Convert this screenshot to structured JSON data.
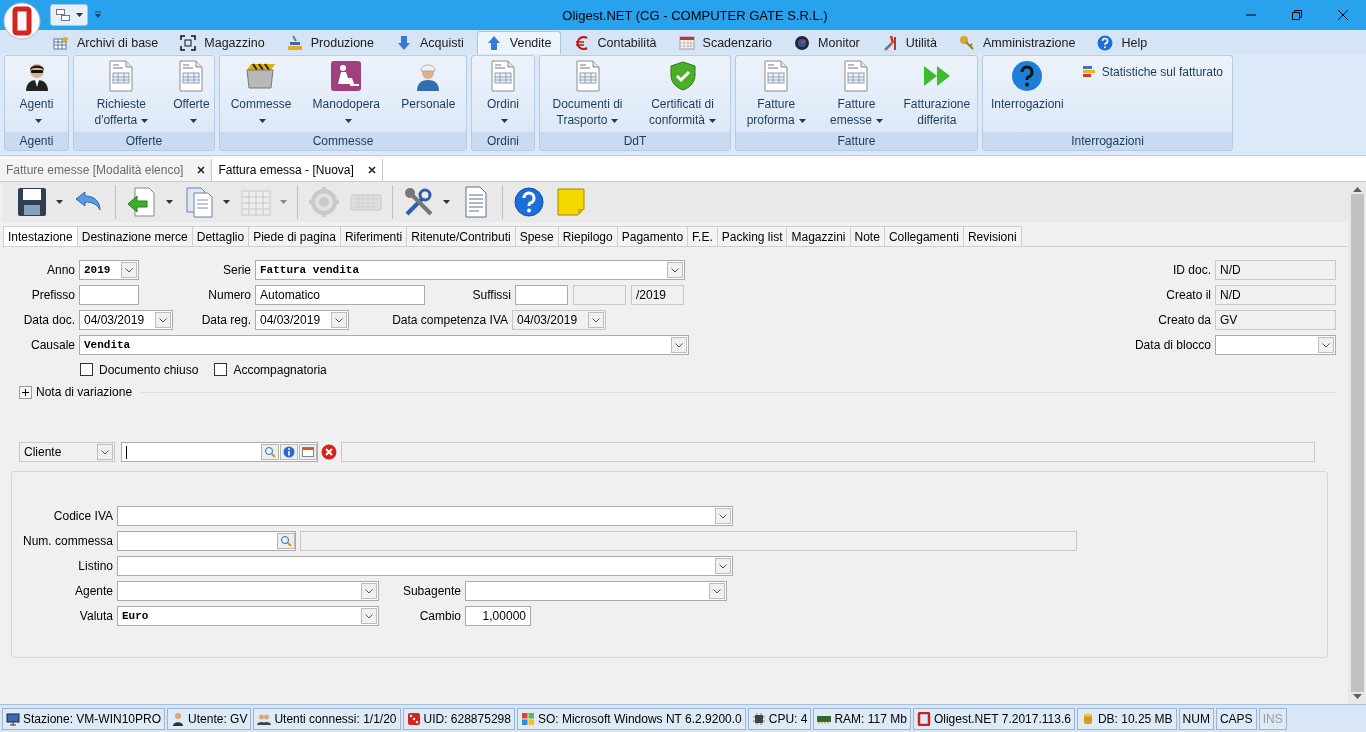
{
  "window": {
    "title": "Oligest.NET (CG - COMPUTER GATE S.R.L.)"
  },
  "menu_tabs": [
    {
      "label": "Archivi di base",
      "kind": "database",
      "selected": false
    },
    {
      "label": "Magazzino",
      "kind": "frame",
      "selected": false
    },
    {
      "label": "Produzione",
      "kind": "production",
      "selected": false
    },
    {
      "label": "Acquisti",
      "kind": "down",
      "selected": false
    },
    {
      "label": "Vendite",
      "kind": "up",
      "selected": true
    },
    {
      "label": "Contabilità",
      "kind": "euro",
      "selected": false
    },
    {
      "label": "Scadenzario",
      "kind": "calendar",
      "selected": false
    },
    {
      "label": "Monitor",
      "kind": "monitor",
      "selected": false
    },
    {
      "label": "Utilità",
      "kind": "tools",
      "selected": false
    },
    {
      "label": "Amministrazione",
      "kind": "keys",
      "selected": false
    },
    {
      "label": "Help",
      "kind": "help",
      "selected": false
    }
  ],
  "ribbon": {
    "groups": [
      {
        "label": "Agenti",
        "items": [
          {
            "label": "Agenti",
            "kind": "agent",
            "dropdown": true
          }
        ]
      },
      {
        "label": "Offerte",
        "items": [
          {
            "label": "Richieste d'offerta",
            "kind": "document",
            "dropdown": true
          },
          {
            "label": "Offerte",
            "kind": "document",
            "dropdown": true
          }
        ]
      },
      {
        "label": "Commesse",
        "items": [
          {
            "label": "Commesse",
            "kind": "folder",
            "dropdown": true
          },
          {
            "label": "Manodopera",
            "kind": "worker",
            "dropdown": true
          },
          {
            "label": "Personale",
            "kind": "engineer",
            "dropdown": false
          }
        ]
      },
      {
        "label": "Ordini",
        "items": [
          {
            "label": "Ordini",
            "kind": "document",
            "dropdown": true
          }
        ]
      },
      {
        "label": "DdT",
        "items": [
          {
            "label": "Documenti di Trasporto",
            "kind": "document",
            "dropdown": true
          },
          {
            "label": "Certificati di conformità",
            "kind": "shield",
            "dropdown": true
          }
        ]
      },
      {
        "label": "Fatture",
        "items": [
          {
            "label": "Fatture proforma",
            "kind": "document",
            "dropdown": true
          },
          {
            "label": "Fatture emesse",
            "kind": "document",
            "dropdown": true
          },
          {
            "label": "Fatturazione differita",
            "kind": "forward",
            "dropdown": false
          }
        ]
      },
      {
        "label": "Interrogazioni",
        "items": [
          {
            "label": "Interrogazioni",
            "kind": "help",
            "dropdown": false
          }
        ],
        "small_items": [
          {
            "label": "Statistiche sul fatturato",
            "kind": "stats"
          }
        ]
      }
    ]
  },
  "doc_tabs": [
    {
      "label": "Fatture emesse [Modalità elenco]",
      "selected": false
    },
    {
      "label": "Fattura emessa - [Nuova]",
      "selected": true
    }
  ],
  "toolbar": [
    {
      "kind": "save",
      "dropdown": true,
      "disabled": false
    },
    {
      "kind": "undo",
      "dropdown": false,
      "disabled": false
    },
    {
      "kind": "separator"
    },
    {
      "kind": "import",
      "dropdown": true,
      "disabled": false
    },
    {
      "kind": "copy",
      "dropdown": true,
      "disabled": false
    },
    {
      "kind": "grid",
      "dropdown": true,
      "disabled": true
    },
    {
      "kind": "separator"
    },
    {
      "kind": "gear",
      "dropdown": false,
      "disabled": true
    },
    {
      "kind": "keyboard",
      "dropdown": false,
      "disabled": true
    },
    {
      "kind": "separator"
    },
    {
      "kind": "tools",
      "dropdown": true,
      "disabled": false
    },
    {
      "kind": "document",
      "dropdown": false,
      "disabled": false
    },
    {
      "kind": "separator"
    },
    {
      "kind": "help",
      "dropdown": false,
      "disabled": false
    },
    {
      "kind": "note",
      "dropdown": false,
      "disabled": false
    }
  ],
  "section_tabs": [
    {
      "label": "Intestazione",
      "selected": true
    },
    {
      "label": "Destinazione merce",
      "selected": false
    },
    {
      "label": "Dettaglio",
      "selected": false
    },
    {
      "label": "Piede di pagina",
      "selected": false
    },
    {
      "label": "Riferimenti",
      "selected": false
    },
    {
      "label": "Ritenute/Contributi",
      "selected": false
    },
    {
      "label": "Spese",
      "selected": false
    },
    {
      "label": "Riepilogo",
      "selected": false
    },
    {
      "label": "Pagamento",
      "selected": false
    },
    {
      "label": "F.E.",
      "selected": false
    },
    {
      "label": "Packing list",
      "selected": false
    },
    {
      "label": "Magazzini",
      "selected": false
    },
    {
      "label": "Note",
      "selected": false
    },
    {
      "label": "Collegamenti",
      "selected": false
    },
    {
      "label": "Revisioni",
      "selected": false
    }
  ],
  "header": {
    "anno": {
      "label": "Anno",
      "value": "2019"
    },
    "serie": {
      "label": "Serie",
      "value": "Fattura vendita"
    },
    "prefisso": {
      "label": "Prefisso"
    },
    "numero": {
      "label": "Numero",
      "value": "Automatico"
    },
    "suffissi": {
      "label": "Suffissi",
      "year": "/2019"
    },
    "data_doc": {
      "label": "Data doc.",
      "value": "04/03/2019"
    },
    "data_reg": {
      "label": "Data reg.",
      "value": "04/03/2019"
    },
    "data_competenza_iva": {
      "label": "Data competenza IVA",
      "value": "04/03/2019",
      "disabled": true
    },
    "causale": {
      "label": "Causale",
      "value": "Vendita"
    },
    "checkboxes": [
      {
        "label": "Documento chiuso",
        "checked": false
      },
      {
        "label": "Accompagnatoria",
        "checked": false
      }
    ]
  },
  "info": [
    {
      "label": "ID doc.",
      "value": "N/D"
    },
    {
      "label": "Creato il",
      "value": "N/D"
    },
    {
      "label": "Creato da",
      "value": "GV"
    }
  ],
  "data_di_blocco": {
    "label": "Data di blocco"
  },
  "nota_di_variazione": {
    "label": "Nota di variazione",
    "expanded": false
  },
  "cliente": {
    "type": "Cliente"
  },
  "details": {
    "codice_iva": {
      "label": "Codice IVA"
    },
    "num_commessa": {
      "label": "Num. commessa"
    },
    "listino": {
      "label": "Listino"
    },
    "agente": {
      "label": "Agente"
    },
    "subagente": {
      "label": "Subagente"
    },
    "valuta": {
      "label": "Valuta",
      "value": "Euro"
    },
    "cambio": {
      "label": "Cambio",
      "value": "1,00000"
    }
  },
  "status_bar": [
    {
      "kind": "station",
      "text": "Stazione: VM-WIN10PRO",
      "disabled": false
    },
    {
      "kind": "user",
      "text": "Utente: GV",
      "disabled": false
    },
    {
      "kind": "users",
      "text": "Utenti connessi: 1/1/20",
      "disabled": false
    },
    {
      "kind": "dice",
      "text": "UID: 628875298",
      "disabled": false
    },
    {
      "kind": "windows",
      "text": "SO: Microsoft Windows NT 6.2.9200.0",
      "disabled": false
    },
    {
      "kind": "cpu",
      "text": "CPU: 4",
      "disabled": false
    },
    {
      "kind": "ram",
      "text": "RAM: 117 Mb",
      "disabled": false
    },
    {
      "kind": "logo",
      "text": "Oligest.NET 7.2017.113.6",
      "disabled": false
    },
    {
      "kind": "db",
      "text": "DB: 10.25 MB",
      "disabled": false
    },
    {
      "kind": "plain",
      "text": "NUM",
      "disabled": false
    },
    {
      "kind": "plain",
      "text": "CAPS",
      "disabled": false
    },
    {
      "kind": "plain",
      "text": "INS",
      "disabled": true
    }
  ]
}
